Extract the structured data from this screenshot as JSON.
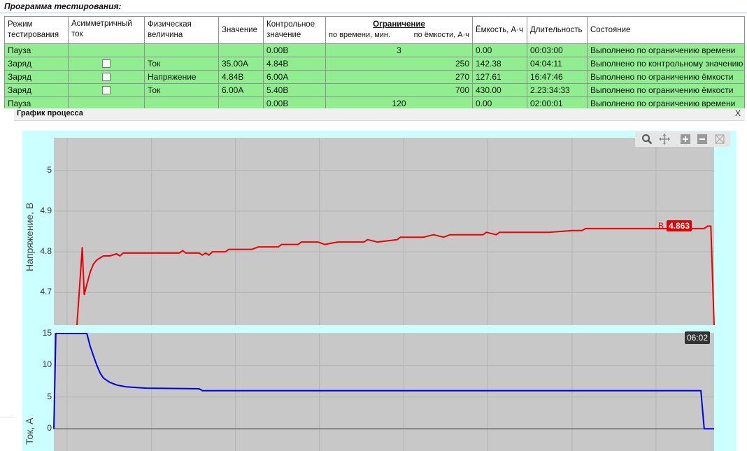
{
  "program": {
    "title": "Программа тестирования:"
  },
  "table": {
    "headers": {
      "mode": "Режим тестирования",
      "asym": "Асимметричный ток",
      "phys": "Физическая величина",
      "value": "Значение",
      "control": "Контрольное значение",
      "limit": "Ограничение",
      "limit_time": "по времени, мин.",
      "limit_cap": "по ёмкости, А·ч",
      "capacity": "Ёмкость, А·ч",
      "duration": "Длительность",
      "state": "Состояние"
    },
    "rows": [
      {
        "mode": "Пауза",
        "asym": "",
        "phys": "",
        "value": "",
        "control": "0.00В",
        "limit_time": "3",
        "limit_cap": "",
        "capacity": "0.00",
        "duration": "00:03:00",
        "state": "Выполнено по ограничению времени"
      },
      {
        "mode": "Заряд",
        "asym": "checkbox",
        "phys": "Ток",
        "value": "35.00А",
        "control": "4.84В",
        "limit_time": "",
        "limit_cap": "250",
        "capacity": "142.38",
        "duration": "04:04:11",
        "state": "Выполнено по контрольному значению"
      },
      {
        "mode": "Заряд",
        "asym": "checkbox",
        "phys": "Напряжение",
        "value": "4.84В",
        "control": "6.00А",
        "limit_time": "",
        "limit_cap": "270",
        "capacity": "127.61",
        "duration": "16:47:46",
        "state": "Выполнено по ограничению ёмкости"
      },
      {
        "mode": "Заряд",
        "asym": "checkbox",
        "phys": "Ток",
        "value": "6.00А",
        "control": "5.40В",
        "limit_time": "",
        "limit_cap": "700",
        "capacity": "430.00",
        "duration": "2.23:34:33",
        "state": "Выполнено по ограничению ёмкости"
      },
      {
        "mode": "Пауза",
        "asym": "",
        "phys": "",
        "value": "",
        "control": "0.00В",
        "limit_time": "120",
        "limit_cap": "",
        "capacity": "0.00",
        "duration": "02:00:01",
        "state": "Выполнено по ограничению времени"
      }
    ]
  },
  "graph_panel": {
    "title": "График процесса",
    "close_label": "X"
  },
  "toolbar": {
    "icons": [
      "zoom-icon",
      "pan-icon",
      "zoom-in-icon",
      "zoom-out-icon",
      "reset-zoom-icon"
    ]
  },
  "colors": {
    "voltage": "#ee0000",
    "current": "#0000dd",
    "plot_bg": "#c8c8c8",
    "frame_bg": "#ccffff",
    "row_bg": "#90ee90"
  },
  "chart_data": [
    {
      "type": "line",
      "ylabel": "Напряжение, В",
      "ylim": [
        4.62,
        5.08
      ],
      "yticks": [
        4.7,
        4.8,
        4.9,
        5
      ],
      "ytick_labels": [
        "4.7",
        "4.8",
        "4.9",
        "5"
      ],
      "grid": true,
      "series": [
        {
          "name": "В",
          "color": "#ee0000",
          "last_value": "4.863",
          "points": [
            [
              0.035,
              4.62
            ],
            [
              0.043,
              4.81
            ],
            [
              0.046,
              4.695
            ],
            [
              0.05,
              4.72
            ],
            [
              0.055,
              4.75
            ],
            [
              0.06,
              4.77
            ],
            [
              0.065,
              4.78
            ],
            [
              0.07,
              4.785
            ],
            [
              0.075,
              4.79
            ],
            [
              0.085,
              4.79
            ],
            [
              0.095,
              4.795
            ],
            [
              0.1,
              4.79
            ],
            [
              0.105,
              4.797
            ],
            [
              0.15,
              4.797
            ],
            [
              0.19,
              4.797
            ],
            [
              0.195,
              4.803
            ],
            [
              0.2,
              4.797
            ],
            [
              0.22,
              4.797
            ],
            [
              0.225,
              4.792
            ],
            [
              0.23,
              4.797
            ],
            [
              0.235,
              4.792
            ],
            [
              0.24,
              4.8
            ],
            [
              0.26,
              4.8
            ],
            [
              0.265,
              4.806
            ],
            [
              0.275,
              4.806
            ],
            [
              0.3,
              4.806
            ],
            [
              0.31,
              4.812
            ],
            [
              0.34,
              4.812
            ],
            [
              0.345,
              4.818
            ],
            [
              0.37,
              4.818
            ],
            [
              0.375,
              4.824
            ],
            [
              0.4,
              4.824
            ],
            [
              0.41,
              4.818
            ],
            [
              0.43,
              4.824
            ],
            [
              0.47,
              4.824
            ],
            [
              0.475,
              4.83
            ],
            [
              0.49,
              4.824
            ],
            [
              0.52,
              4.83
            ],
            [
              0.525,
              4.836
            ],
            [
              0.56,
              4.836
            ],
            [
              0.575,
              4.842
            ],
            [
              0.59,
              4.836
            ],
            [
              0.6,
              4.842
            ],
            [
              0.65,
              4.842
            ],
            [
              0.655,
              4.848
            ],
            [
              0.67,
              4.842
            ],
            [
              0.675,
              4.848
            ],
            [
              0.7,
              4.848
            ],
            [
              0.75,
              4.848
            ],
            [
              0.785,
              4.852
            ],
            [
              0.8,
              4.852
            ],
            [
              0.805,
              4.857
            ],
            [
              0.88,
              4.857
            ],
            [
              0.985,
              4.857
            ],
            [
              0.99,
              4.863
            ],
            [
              0.995,
              4.863
            ],
            [
              1.0,
              4.62
            ]
          ]
        }
      ]
    },
    {
      "type": "line",
      "ylabel": "Ток, А",
      "ylim": [
        -3.5,
        15
      ],
      "yticks": [
        0,
        5,
        10,
        15
      ],
      "ytick_labels": [
        "0",
        "5",
        "10",
        "15"
      ],
      "grid": true,
      "cursor_time_label": "06:02",
      "series": [
        {
          "name": "",
          "color": "#0000dd",
          "points": [
            [
              0.0,
              0
            ],
            [
              0.003,
              15
            ],
            [
              0.05,
              15
            ],
            [
              0.055,
              13
            ],
            [
              0.06,
              11.5
            ],
            [
              0.065,
              10
            ],
            [
              0.07,
              8.8
            ],
            [
              0.075,
              8
            ],
            [
              0.085,
              7.3
            ],
            [
              0.095,
              6.9
            ],
            [
              0.11,
              6.6
            ],
            [
              0.14,
              6.4
            ],
            [
              0.22,
              6.3
            ],
            [
              0.225,
              6.0
            ],
            [
              0.98,
              6.0
            ],
            [
              0.985,
              0.0
            ],
            [
              1.0,
              0.0
            ]
          ]
        }
      ]
    }
  ]
}
